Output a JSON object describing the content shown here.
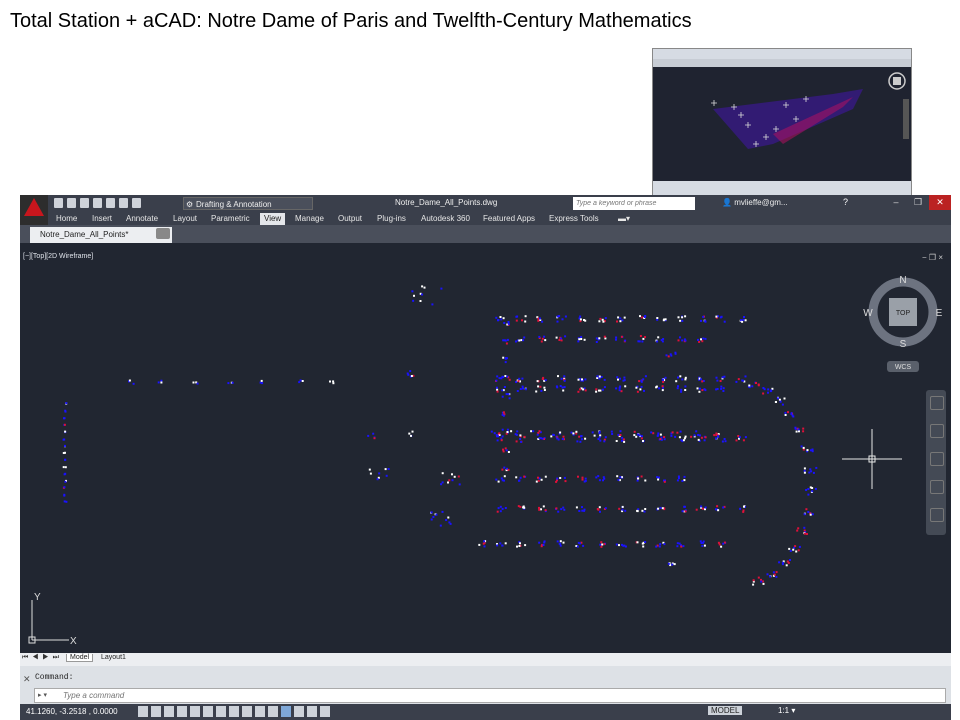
{
  "slide": {
    "title": "Total Station + aCAD: Notre Dame of Paris and Twelfth-Century Mathematics"
  },
  "app": {
    "workspace": "Drafting & Annotation",
    "document_title": "Notre_Dame_All_Points.dwg",
    "search_placeholder": "Type a keyword or phrase",
    "user": "mvlieffe@gm...",
    "help": "?"
  },
  "ribbon": {
    "tabs": [
      "Home",
      "Insert",
      "Annotate",
      "Layout",
      "Parametric",
      "View",
      "Manage",
      "Output",
      "Plug-ins",
      "Autodesk 360",
      "Featured Apps",
      "Express Tools"
    ],
    "active_tab": "View"
  },
  "file_tabs": [
    {
      "label": "Notre_Dame_All_Points*",
      "close": "×"
    }
  ],
  "viewport": {
    "label": "[−][Top][2D Wireframe]",
    "controls": "− ❐ ×",
    "viewcube": {
      "top": "TOP",
      "n": "N",
      "s": "S",
      "e": "E",
      "w": "W"
    },
    "wcs": "WCS",
    "ucs": {
      "x": "X",
      "y": "Y"
    }
  },
  "layout_tabs": {
    "nav": "⏮ ◀ ▶ ⏭",
    "model": "Model",
    "layout1": "Layout1"
  },
  "command": {
    "history": "Command:",
    "prompt": "▸ ▾",
    "placeholder": "Type a command"
  },
  "status": {
    "coordinates": "41.1260, -3.2518 , 0.0000",
    "model": "MODEL",
    "scale": "1:1 ▾"
  },
  "colors": {
    "canvas": "#212631",
    "point_blue": "#1a12ff",
    "point_white": "#ffffff",
    "point_red": "#e0103a",
    "accent_red": "#c8161d"
  }
}
